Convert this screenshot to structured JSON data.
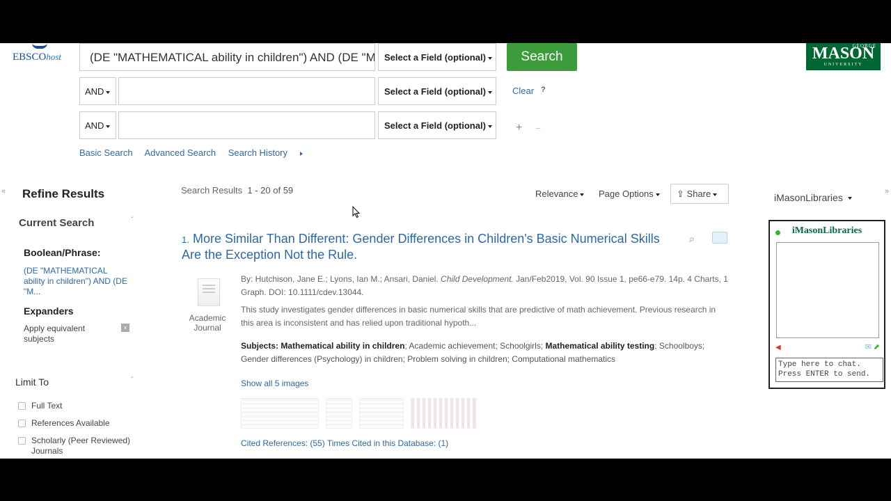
{
  "logo": {
    "ebsco": "EBSCO",
    "host": "host"
  },
  "university_logo": {
    "top": "GEORGE",
    "main": "MASON",
    "bottom": "UNIVERSITY"
  },
  "search": {
    "row1_text": "(DE \"MATHEMATICAL ability in children\") AND (DE \"M",
    "field_label": "Select a Field (optional)",
    "button": "Search",
    "bool_op": "AND",
    "clear": "Clear",
    "help": "?",
    "add": "+",
    "remove": "−"
  },
  "search_links": [
    "Basic Search",
    "Advanced Search",
    "Search History"
  ],
  "refine": {
    "title": "Refine Results",
    "current_search": "Current Search",
    "boolean_label": "Boolean/Phrase:",
    "boolean_value": "(DE \"MATHEMATICAL ability in children\") AND (DE \"M...",
    "expanders_label": "Expanders",
    "expanders_value": "Apply equivalent subjects",
    "limit_to": "Limit To",
    "limits": [
      "Full Text",
      "References Available",
      "Scholarly (Peer Reviewed) Journals"
    ]
  },
  "results": {
    "label": "Search Results",
    "range": "1 - 20 of 59",
    "sort": "Relevance",
    "page_options": "Page Options",
    "share": "Share"
  },
  "result1": {
    "number": "1.",
    "title": "More Similar Than Different: Gender Differences in Children's Basic Numerical Skills Are the Exception Not the Rule.",
    "doc_type": "Academic Journal",
    "byline_pre": "By: Hutchison, Jane E.; Lyons, Ian M.; Ansari, Daniel.",
    "journal": "Child Development.",
    "byline_post": "Jan/Feb2019, Vol. 90 Issue 1, pe66-e79. 14p. 4 Charts, 1 Graph. DOI: 10.1111/cdev.13044.",
    "abstract": "This study investigates gender differences in basic numerical skills that are predictive of math achievement. Previous research in this area is inconsistent and has relied upon traditional hypoth...",
    "subjects_label": "Subjects:",
    "subject1": "Mathematical ability in children",
    "subjects_mid": "; Academic achievement; Schoolgirls;",
    "subject2": "Mathematical ability testing",
    "subjects_end": "; Schoolboys; Gender differences (Psychology) in children; Problem solving in children; Computational mathematics",
    "show_images": "Show all 5 images",
    "cited_refs": "Cited References: (55)",
    "times_cited": "Times Cited in this Database: (1)"
  },
  "chat": {
    "top_label": "iMasonLibraries",
    "title": "iMasonLibraries",
    "input_placeholder": "Type here to chat. Press ENTER to send."
  },
  "collapse": {
    "left": "«",
    "right": "»"
  }
}
